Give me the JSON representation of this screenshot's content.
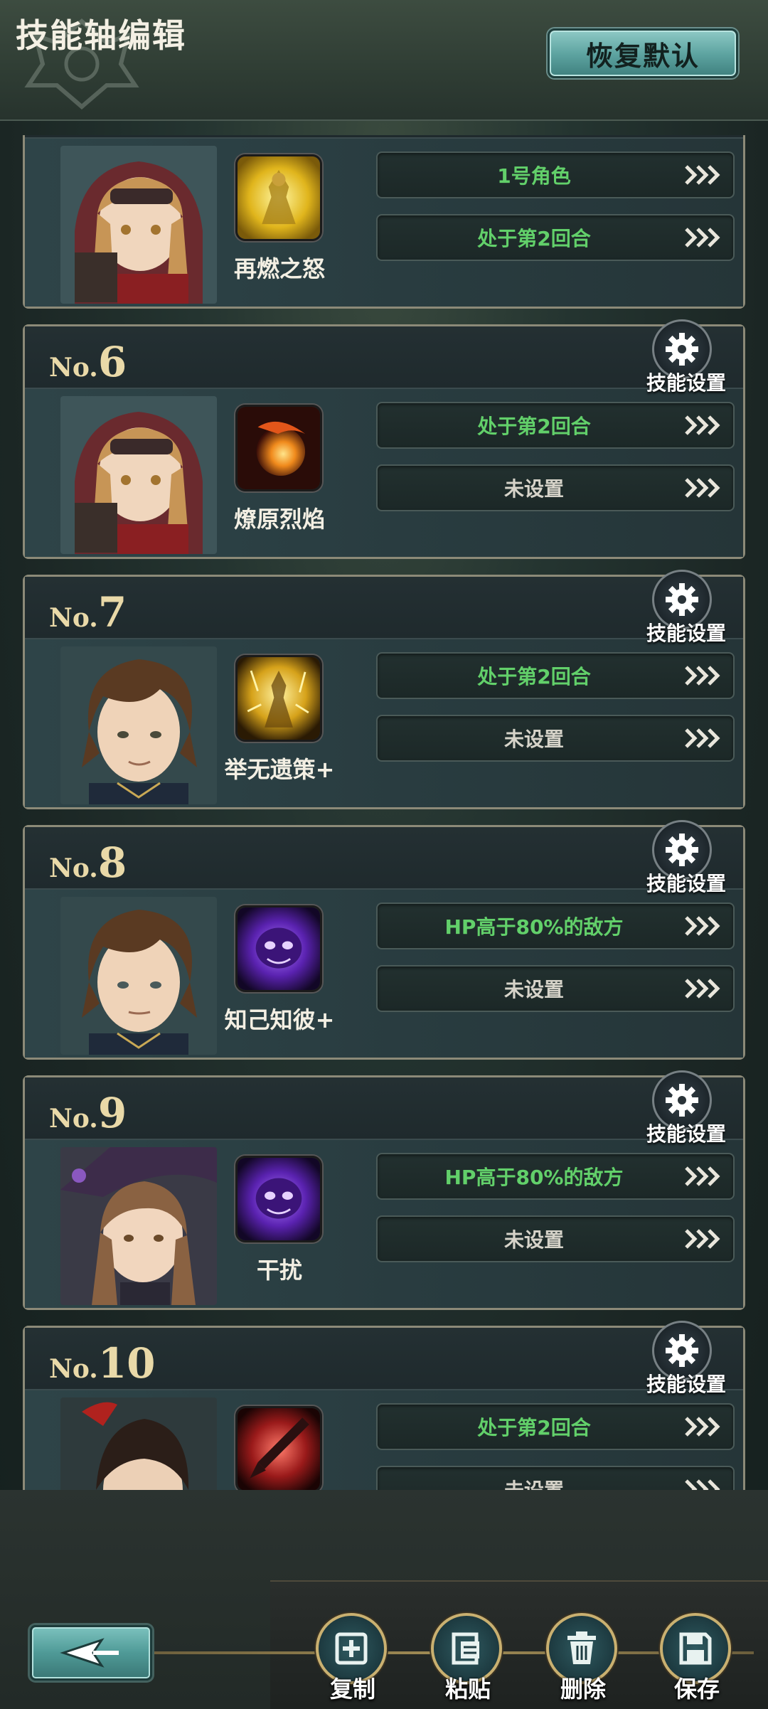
{
  "header": {
    "title": "技能轴编辑",
    "restore_label": "恢复默认"
  },
  "cards": [
    {
      "no_prefix": "No.",
      "no": "",
      "skill_name": "再燃之怒",
      "cond1": "1号角色",
      "cond1_color": "green",
      "cond2": "处于第2回合",
      "cond2_color": "green",
      "setting_label": "",
      "icon": "rage-rekindle-icon",
      "portrait": "red-hood-girl-portrait"
    },
    {
      "no_prefix": "No.",
      "no": "6",
      "skill_name": "燎原烈焰",
      "cond1": "处于第2回合",
      "cond1_color": "green",
      "cond2": "未设置",
      "cond2_color": "gray",
      "setting_label": "技能设置",
      "icon": "fireball-icon",
      "portrait": "red-hood-girl-portrait"
    },
    {
      "no_prefix": "No.",
      "no": "7",
      "skill_name": "举无遗策+",
      "cond1": "处于第2回合",
      "cond1_color": "green",
      "cond2": "未设置",
      "cond2_color": "gray",
      "setting_label": "技能设置",
      "icon": "golden-aura-icon",
      "portrait": "brown-hair-man-portrait"
    },
    {
      "no_prefix": "No.",
      "no": "8",
      "skill_name": "知己知彼+",
      "cond1": "HP高于80%的敌方",
      "cond1_color": "green",
      "cond2": "未设置",
      "cond2_color": "gray",
      "setting_label": "技能设置",
      "icon": "purple-skull-icon",
      "portrait": "brown-hair-man-portrait"
    },
    {
      "no_prefix": "No.",
      "no": "9",
      "skill_name": "干扰",
      "cond1": "HP高于80%的敌方",
      "cond1_color": "green",
      "cond2": "未设置",
      "cond2_color": "gray",
      "setting_label": "技能设置",
      "icon": "purple-skull-icon",
      "portrait": "witch-hat-girl-portrait"
    },
    {
      "no_prefix": "No.",
      "no": "10",
      "skill_name": "",
      "cond1": "处于第2回合",
      "cond1_color": "green",
      "cond2": "未设置",
      "cond2_color": "gray",
      "setting_label": "技能设置",
      "icon": "crimson-sword-icon",
      "portrait": "red-hairpin-woman-portrait"
    }
  ],
  "bottom": {
    "back_icon": "back-arrow-icon",
    "actions": [
      {
        "label": "复制",
        "icon": "copy-icon"
      },
      {
        "label": "粘贴",
        "icon": "paste-icon"
      },
      {
        "label": "删除",
        "icon": "trash-icon"
      },
      {
        "label": "保存",
        "icon": "save-icon"
      }
    ]
  },
  "colors": {
    "accent_teal": "#5fa5a2",
    "condition_green": "#62d06a",
    "number_gold": "#e9d9a8",
    "frame_gold": "#c9b070"
  }
}
